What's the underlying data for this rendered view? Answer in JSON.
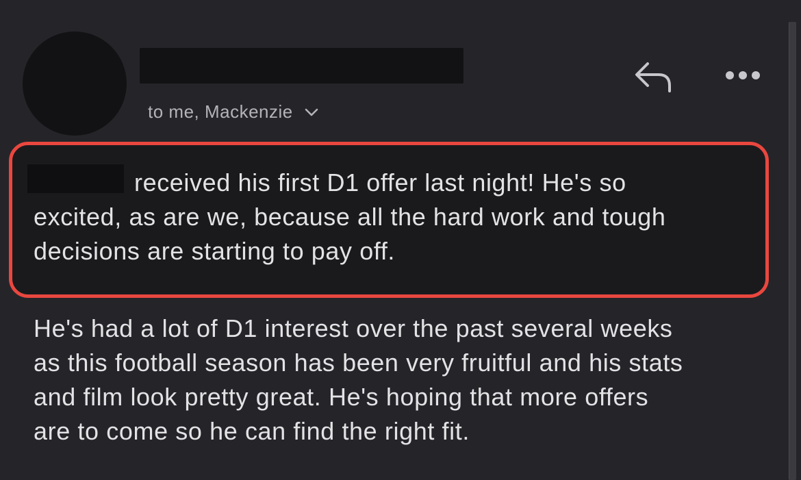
{
  "header": {
    "recipients": "to me, Mackenzie"
  },
  "icons": {
    "reply": "reply-arrow-icon",
    "more": "more-horizontal-icon",
    "expand": "chevron-down-icon"
  },
  "colors": {
    "background": "#252529",
    "highlight_border": "#e9473f",
    "text": "#e3e3e6",
    "secondary_text": "#b4b4b8",
    "redaction": "#121214"
  },
  "body": {
    "paragraph1_lines": [
      "received his first D1 offer last night! He's so",
      "excited, as are we, because all the hard work and tough",
      "decisions are starting to pay off."
    ],
    "paragraph2_lines": [
      "He's had a lot of D1 interest over the past several weeks",
      "as this football season has been very fruitful and his stats",
      "and film look pretty great. He's hoping that more offers",
      "are to come so he can find the right fit."
    ]
  }
}
